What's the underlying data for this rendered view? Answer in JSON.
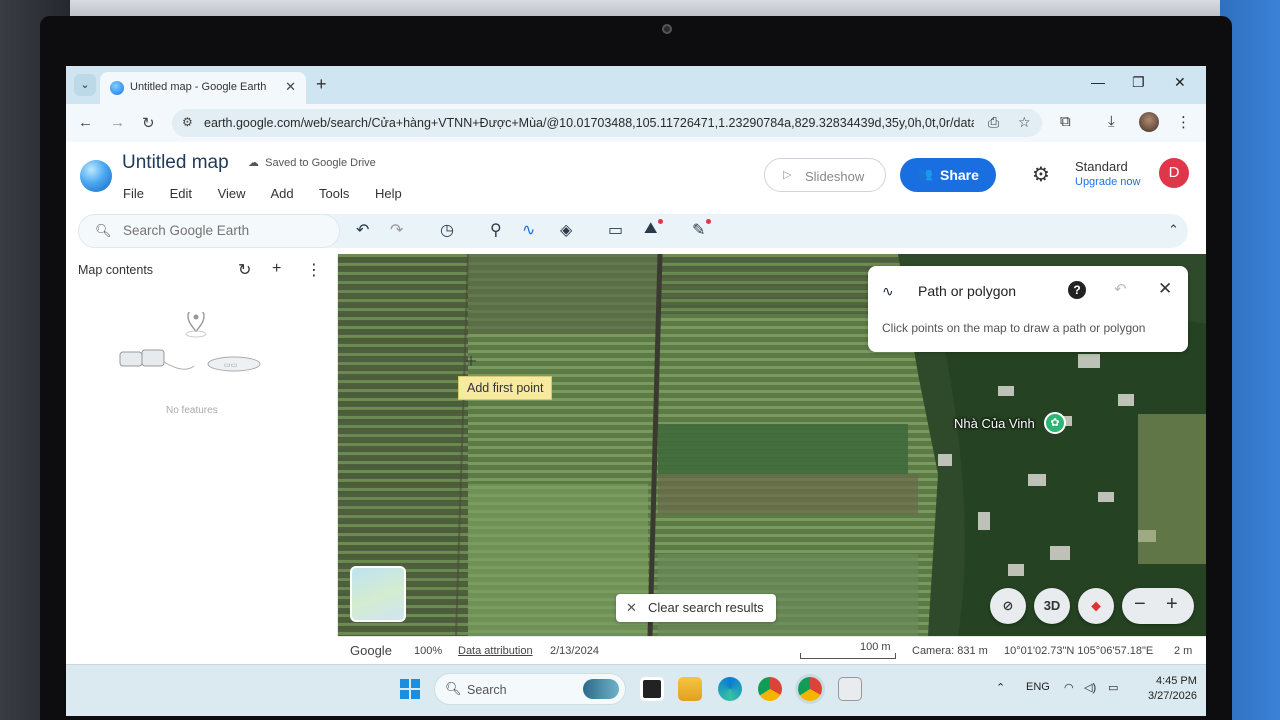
{
  "browser": {
    "tab_title": "Untitled map - Google Earth",
    "url": "earth.google.com/web/search/Cửa+hàng+VTNN+Được+Mùa/@10.01703488,105.11726471,1.23290784a,829.32834439d,35y,0h,0t,0r/data..."
  },
  "header": {
    "title": "Untitled map",
    "saved_status": "Saved to Google Drive",
    "menu": [
      "File",
      "Edit",
      "View",
      "Add",
      "Tools",
      "Help"
    ],
    "slideshow_label": "Slideshow",
    "share_label": "Share",
    "plan_label": "Standard",
    "upgrade_label": "Upgrade now",
    "avatar_letter": "D"
  },
  "toolbar": {
    "search_placeholder": "Search Google Earth"
  },
  "panel": {
    "title": "Map contents",
    "empty_text": "No features"
  },
  "map": {
    "path_card": {
      "title": "Path or polygon",
      "hint": "Click points on the map to draw a path or polygon"
    },
    "tooltip": "Add first point",
    "place_label": "Nhà Của Vinh",
    "clear_search_label": "Clear search results",
    "view_3d_label": "3D"
  },
  "status": {
    "brand": "Google",
    "zoom": "100%",
    "attribution": "Data attribution",
    "imagery_date": "2/13/2024",
    "scale": "100 m",
    "camera": "Camera: 831 m",
    "coords": "10°01'02.73\"N 105°06'57.18\"E",
    "elevation": "2 m"
  },
  "taskbar": {
    "search_label": "Search",
    "language": "ENG",
    "time": "4:45 PM",
    "date": "3/27/2026"
  },
  "colors": {
    "accent": "#1a6fe0",
    "avatar": "#e0364a",
    "tooltip": "#f6e9a0",
    "place_icon": "#2bb673"
  }
}
